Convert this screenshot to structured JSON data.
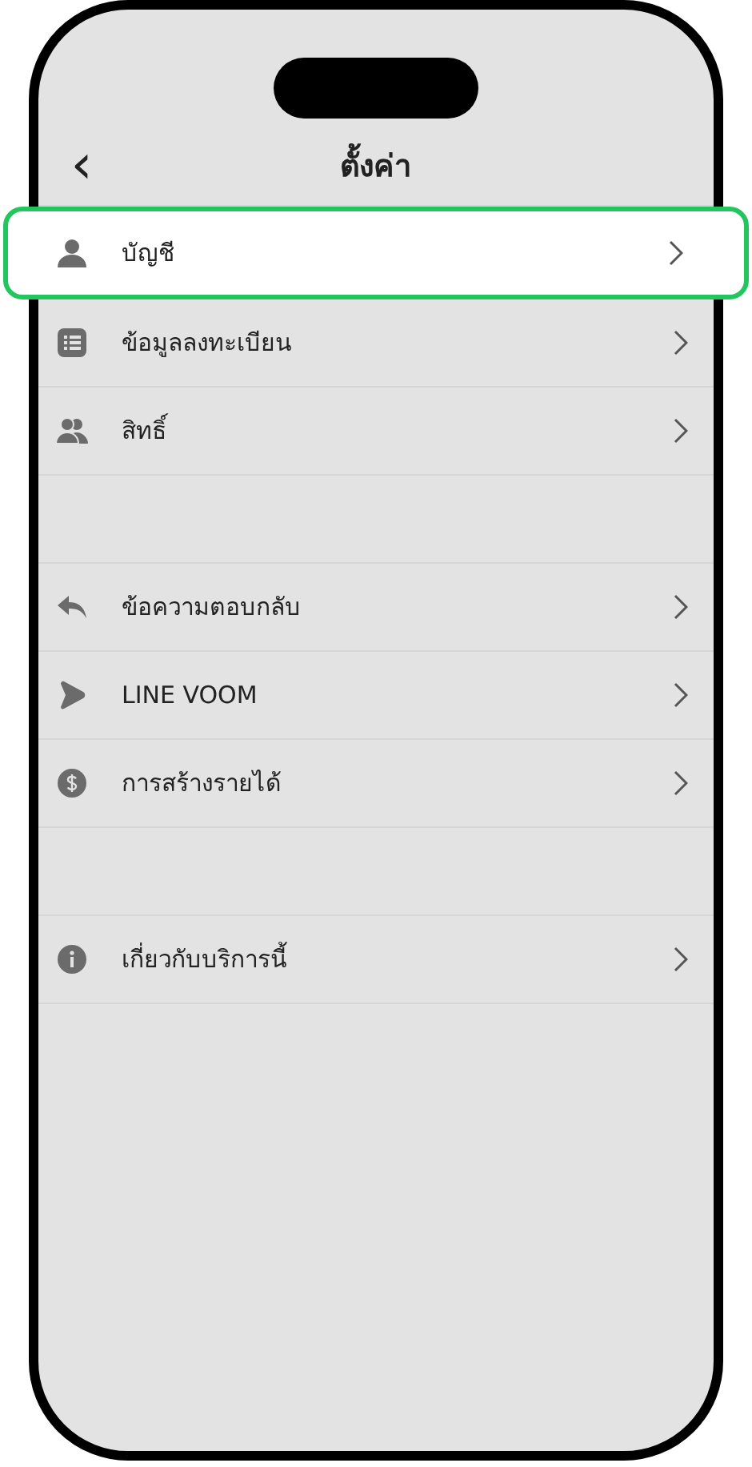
{
  "header": {
    "back": "‹",
    "title": "ตั้งค่า"
  },
  "sections": [
    {
      "items": [
        {
          "label": "บัญชี",
          "selected": true
        },
        {
          "label": "ข้อมูลลงทะเบียน",
          "selected": false
        },
        {
          "label": "สิทธิ์",
          "selected": false
        }
      ]
    },
    {
      "items": [
        {
          "label": "ข้อความตอบกลับ",
          "selected": false
        },
        {
          "label": "LINE VOOM",
          "selected": false
        },
        {
          "label": "การสร้างรายได้",
          "selected": false
        }
      ]
    },
    {
      "items": [
        {
          "label": "เกี่ยวกับบริการนี้",
          "selected": false
        }
      ]
    }
  ]
}
